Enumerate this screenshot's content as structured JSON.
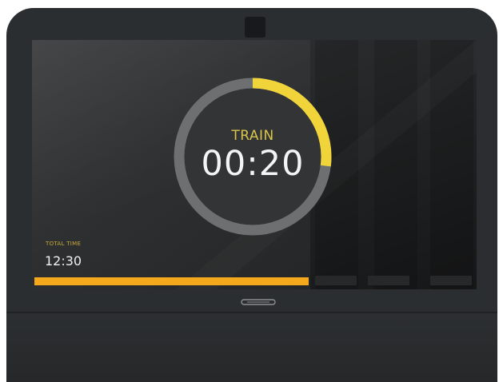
{
  "timer": {
    "phase_label": "TRAIN",
    "time": "00:20",
    "ring_progress": 0.27,
    "ring_color": "#f0d43a",
    "ring_track_color": "#6e6f70"
  },
  "total": {
    "label": "TOTAL TIME",
    "value": "12:30"
  },
  "progress_bar": {
    "fill_fraction": 1.0,
    "color": "#f5a81c"
  },
  "icons": {
    "camera": "camera-icon",
    "logo": "brand-logo-icon"
  }
}
